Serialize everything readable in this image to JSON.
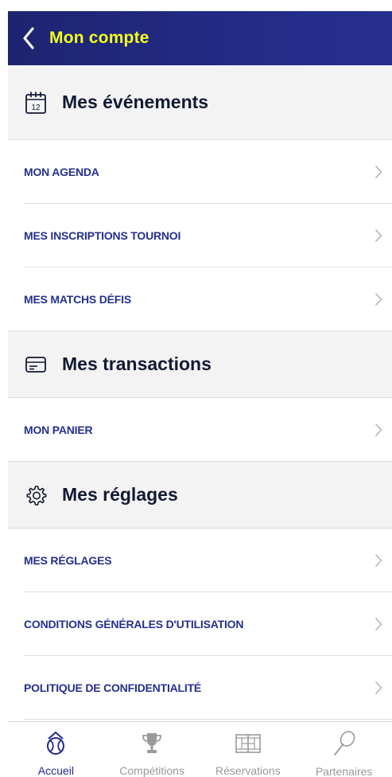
{
  "header": {
    "title": "Mon compte",
    "back_icon": "chevron-left-icon",
    "background": "#1d2470",
    "title_color": "#f3ff1f"
  },
  "sections": [
    {
      "title": "Mes événements",
      "icon": "calendar-icon",
      "calendar_day": "12",
      "items": [
        {
          "label": "MON AGENDA"
        },
        {
          "label": "MES INSCRIPTIONS TOURNOI"
        },
        {
          "label": "MES MATCHS DÉFIS"
        }
      ]
    },
    {
      "title": "Mes transactions",
      "icon": "card-icon",
      "items": [
        {
          "label": "MON PANIER"
        }
      ]
    },
    {
      "title": "Mes réglages",
      "icon": "gear-icon",
      "items": [
        {
          "label": "MES RÉGLAGES"
        },
        {
          "label": "CONDITIONS GÉNÉRALES D'UTILISATION"
        },
        {
          "label": "POLITIQUE DE CONFIDENTIALITÉ"
        }
      ]
    }
  ],
  "tabbar": {
    "tabs": [
      {
        "label": "Accueil",
        "icon": "tennis-ball-icon",
        "active": true
      },
      {
        "label": "Compétitions",
        "icon": "trophy-icon",
        "active": false
      },
      {
        "label": "Réservations",
        "icon": "court-icon",
        "active": false
      },
      {
        "label": "Partenaires",
        "icon": "racket-icon",
        "active": false
      }
    ]
  },
  "colors": {
    "accent": "#24308f",
    "section_bg": "#f3f3f3",
    "inactive_tab": "#9a9a9a"
  }
}
